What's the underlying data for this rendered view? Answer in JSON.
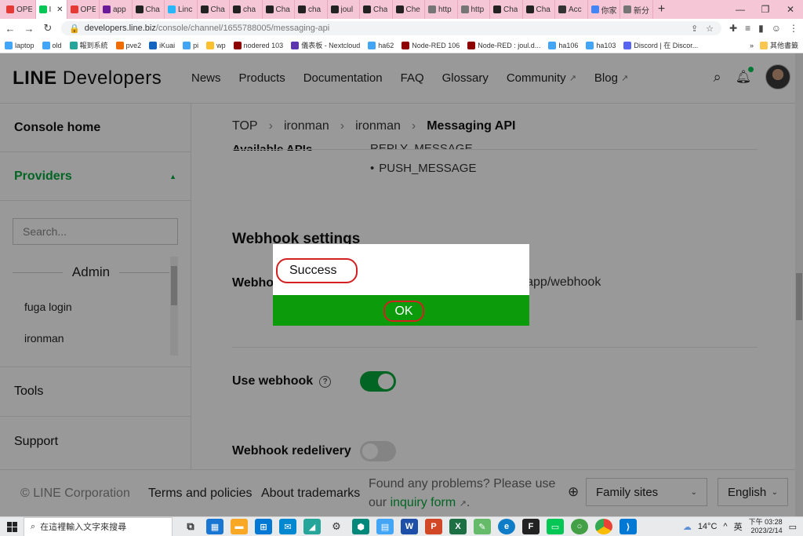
{
  "browser": {
    "tabs": [
      {
        "label": "OPE",
        "color": "#e53935"
      },
      {
        "label": "I",
        "color": "#06c755",
        "active": true
      },
      {
        "label": "OPE",
        "color": "#e53935"
      },
      {
        "label": "app",
        "color": "#6a1b9a"
      },
      {
        "label": "Cha",
        "color": "#222222"
      },
      {
        "label": "Linc",
        "color": "#29b6f6"
      },
      {
        "label": "Cha",
        "color": "#222222"
      },
      {
        "label": "cha",
        "color": "#222222"
      },
      {
        "label": "Cha",
        "color": "#222222"
      },
      {
        "label": "cha",
        "color": "#222222"
      },
      {
        "label": "joul",
        "color": "#222222"
      },
      {
        "label": "Cha",
        "color": "#222222"
      },
      {
        "label": "Che",
        "color": "#222222"
      },
      {
        "label": "http",
        "color": "#757575"
      },
      {
        "label": "http",
        "color": "#757575"
      },
      {
        "label": "Cha",
        "color": "#222222"
      },
      {
        "label": "Cha",
        "color": "#222222"
      },
      {
        "label": "Acc",
        "color": "#333333"
      },
      {
        "label": "你家",
        "color": "#4285f4"
      },
      {
        "label": "新分",
        "color": "#757575"
      }
    ],
    "url_host": "developers.line.biz",
    "url_path": "/console/channel/1655788005/messaging-api",
    "bookmarks": [
      {
        "label": "laptop",
        "color": "#42a5f5"
      },
      {
        "label": "old",
        "color": "#42a5f5"
      },
      {
        "label": "報到系統",
        "color": "#26a69a"
      },
      {
        "label": "pve2",
        "color": "#ef6c00"
      },
      {
        "label": "iKuai",
        "color": "#1565c0"
      },
      {
        "label": "pi",
        "color": "#42a5f5"
      },
      {
        "label": "wp",
        "color": "#fbc02d"
      },
      {
        "label": "nodered 103",
        "color": "#8e0000"
      },
      {
        "label": "儀表板 - Nextcloud",
        "color": "#5e35b1"
      },
      {
        "label": "ha62",
        "color": "#42a5f5"
      },
      {
        "label": "Node-RED 106",
        "color": "#8e0000"
      },
      {
        "label": "Node-RED : joul.d...",
        "color": "#8e0000"
      },
      {
        "label": "ha106",
        "color": "#42a5f5"
      },
      {
        "label": "ha103",
        "color": "#42a5f5"
      },
      {
        "label": "Discord | 在 Discor...",
        "color": "#5865f2"
      }
    ],
    "bookmarks_more": "»",
    "other_bookmarks": "其他書籤"
  },
  "header": {
    "logo_line": "LINE",
    "logo_dev": "Developers",
    "nav": [
      {
        "label": "News",
        "external": false
      },
      {
        "label": "Products",
        "external": false
      },
      {
        "label": "Documentation",
        "external": false
      },
      {
        "label": "FAQ",
        "external": false
      },
      {
        "label": "Glossary",
        "external": false
      },
      {
        "label": "Community",
        "external": true
      },
      {
        "label": "Blog",
        "external": true
      }
    ]
  },
  "sidebar": {
    "console_home": "Console home",
    "providers": "Providers",
    "search_placeholder": "Search...",
    "group": "Admin",
    "items": [
      "fuga login",
      "ironman"
    ],
    "tools": "Tools",
    "support": "Support"
  },
  "breadcrumb": [
    "TOP",
    "ironman",
    "ironman",
    "Messaging API"
  ],
  "content": {
    "apis_label": "Available APIs",
    "api_partial": "REPLY_MESSAGE",
    "api_bullet": "PUSH_MESSAGE",
    "webhook_title": "Webhook settings",
    "webhook_url_label": "Webhook URL",
    "webhook_url_value": "vercel.app/webhook",
    "use_webhook": "Use webhook",
    "use_webhook_on": true,
    "redelivery": "Webhook redelivery",
    "redelivery_on": false
  },
  "footer": {
    "copyright": "© LINE Corporation",
    "terms": "Terms and policies",
    "trademarks": "About trademarks",
    "problems": "Found any problems? Please use our",
    "inquiry": "inquiry form",
    "problems_end": ".",
    "family_sites": "Family sites",
    "language": "English"
  },
  "modal": {
    "message": "Success",
    "ok": "OK"
  },
  "taskbar": {
    "search_placeholder": "在這裡輸入文字來搜尋",
    "weather": "14°C",
    "ime": "英",
    "time": "下午 03:28",
    "date": "2023/2/14"
  },
  "colors": {
    "line_green": "#06a83d",
    "modal_green": "#0b9b0b",
    "annotation_red": "#d32020"
  }
}
